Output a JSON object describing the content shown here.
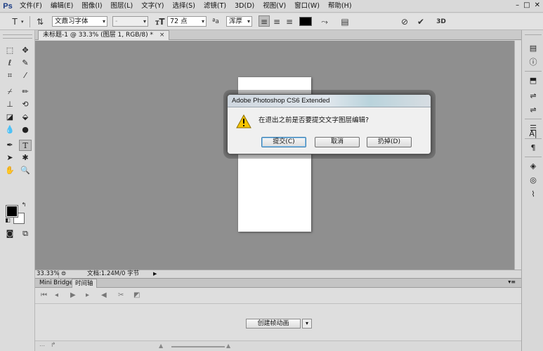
{
  "app": {
    "logo": "Ps"
  },
  "menu": [
    "文件(F)",
    "编辑(E)",
    "图像(I)",
    "图层(L)",
    "文字(Y)",
    "选择(S)",
    "滤镜(T)",
    "3D(D)",
    "视图(V)",
    "窗口(W)",
    "帮助(H)"
  ],
  "options": {
    "tool_glyph": "T",
    "font_family": "文鼎习字体",
    "font_style": "-",
    "font_size": "72 点",
    "aa_label": "ªa",
    "anti_alias": "浑厚",
    "text_color": "#000000",
    "threed_label": "3D"
  },
  "document": {
    "tab_title": "未标题-1 @ 33.3% (图层 1, RGB/8) *",
    "close": "×"
  },
  "status": {
    "zoom": "33.33%",
    "doc_info": "文档:1.24M/0 字节"
  },
  "bottom_panel": {
    "tabs": [
      "Mini Bridge",
      "时间轴"
    ],
    "create_button": "创建帧动画"
  },
  "dialog": {
    "title": "Adobe Photoshop CS6 Extended",
    "message": "在退出之前是否要提交文字图层编辑?",
    "buttons": [
      "提交(C)",
      "取消",
      "扔掉(D)"
    ]
  },
  "colors": {
    "foreground": "#000000",
    "background": "#ffffff",
    "canvas": "#8f8f8f"
  }
}
